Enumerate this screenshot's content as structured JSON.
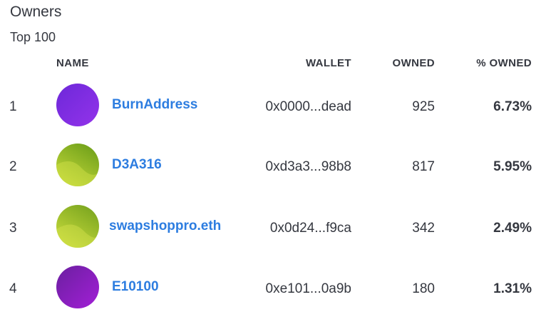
{
  "panel": {
    "title": "Owners",
    "subtitle": "Top 100"
  },
  "columns": {
    "name": "NAME",
    "wallet": "WALLET",
    "owned": "OWNED",
    "pct_owned": "% OWNED"
  },
  "rows": [
    {
      "rank": "1",
      "name": "BurnAddress",
      "wallet": "0x0000...dead",
      "owned": "925",
      "pct": "6.73%",
      "avatar_colors": [
        "#6d28d9",
        "#9333ea"
      ]
    },
    {
      "rank": "2",
      "name": "D3A316",
      "wallet": "0xd3a3...98b8",
      "owned": "817",
      "pct": "5.95%",
      "avatar_colors": [
        "#6fa01a",
        "#c5d93a"
      ]
    },
    {
      "rank": "3",
      "name": "swapshoppro.eth",
      "wallet": "0x0d24...f9ca",
      "owned": "342",
      "pct": "2.49%",
      "avatar_colors": [
        "#7aa51f",
        "#c9dc3c"
      ]
    },
    {
      "rank": "4",
      "name": "E10100",
      "wallet": "0xe101...0a9b",
      "owned": "180",
      "pct": "1.31%",
      "avatar_colors": [
        "#6b1fa0",
        "#a21fd6"
      ]
    }
  ]
}
